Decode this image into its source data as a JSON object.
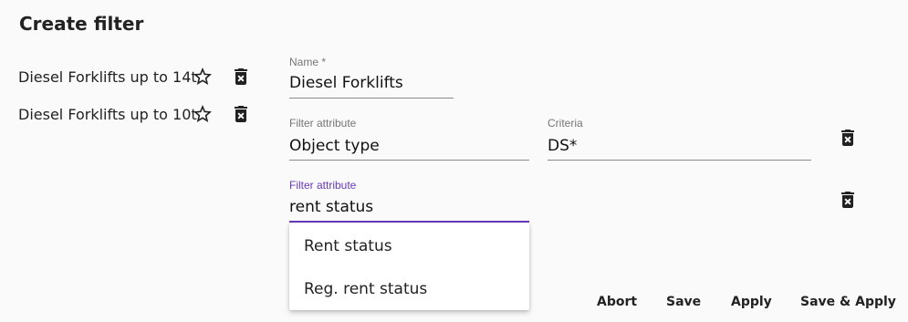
{
  "page": {
    "title": "Create filter"
  },
  "saved_filters": [
    {
      "label": "Diesel Forklifts up to 14t",
      "star_icon": "star-outline-icon",
      "delete_icon": "delete-icon"
    },
    {
      "label": "Diesel Forklifts up to 10t",
      "star_icon": "star-outline-icon",
      "delete_icon": "delete-icon"
    }
  ],
  "form": {
    "name": {
      "label": "Name *",
      "value": "Diesel Forklifts"
    },
    "rows": [
      {
        "attribute": {
          "label": "Filter attribute",
          "value": "Object type"
        },
        "criteria": {
          "label": "Criteria",
          "value": "DS*"
        }
      },
      {
        "attribute": {
          "label": "Filter attribute",
          "value": "rent status"
        }
      }
    ]
  },
  "dropdown": {
    "options": [
      "Rent status",
      "Reg. rent status"
    ]
  },
  "actions": {
    "abort": "Abort",
    "save": "Save",
    "apply": "Apply",
    "save_apply": "Save & Apply"
  },
  "colors": {
    "accent": "#673ab7",
    "underline": "#8a8a8a",
    "icon": "#212121"
  }
}
